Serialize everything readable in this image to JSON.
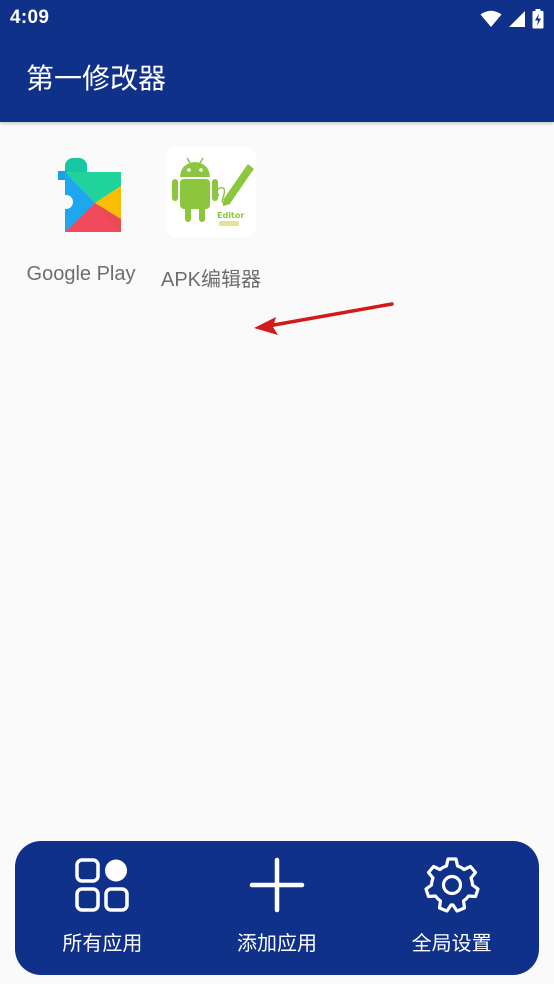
{
  "status_bar": {
    "time": "4:09",
    "icons": [
      "wifi-icon",
      "signal-icon",
      "battery-charging-icon"
    ]
  },
  "app_bar": {
    "title": "第一修改器"
  },
  "apps": [
    {
      "name": "Google Play",
      "icon": "google-play-services-icon"
    },
    {
      "name": "APK编辑器",
      "icon": "apk-editor-icon",
      "icon_text": "Editor"
    }
  ],
  "bottom_nav": {
    "items": [
      {
        "label": "所有应用",
        "icon": "grid-apps-icon"
      },
      {
        "label": "添加应用",
        "icon": "plus-icon"
      },
      {
        "label": "全局设置",
        "icon": "gear-icon"
      }
    ]
  },
  "colors": {
    "primary": "#10318a",
    "background": "#fafafa",
    "label_text": "#6e6e6e",
    "annotation_arrow": "#d11a1a",
    "android_green": "#8cc63f"
  }
}
